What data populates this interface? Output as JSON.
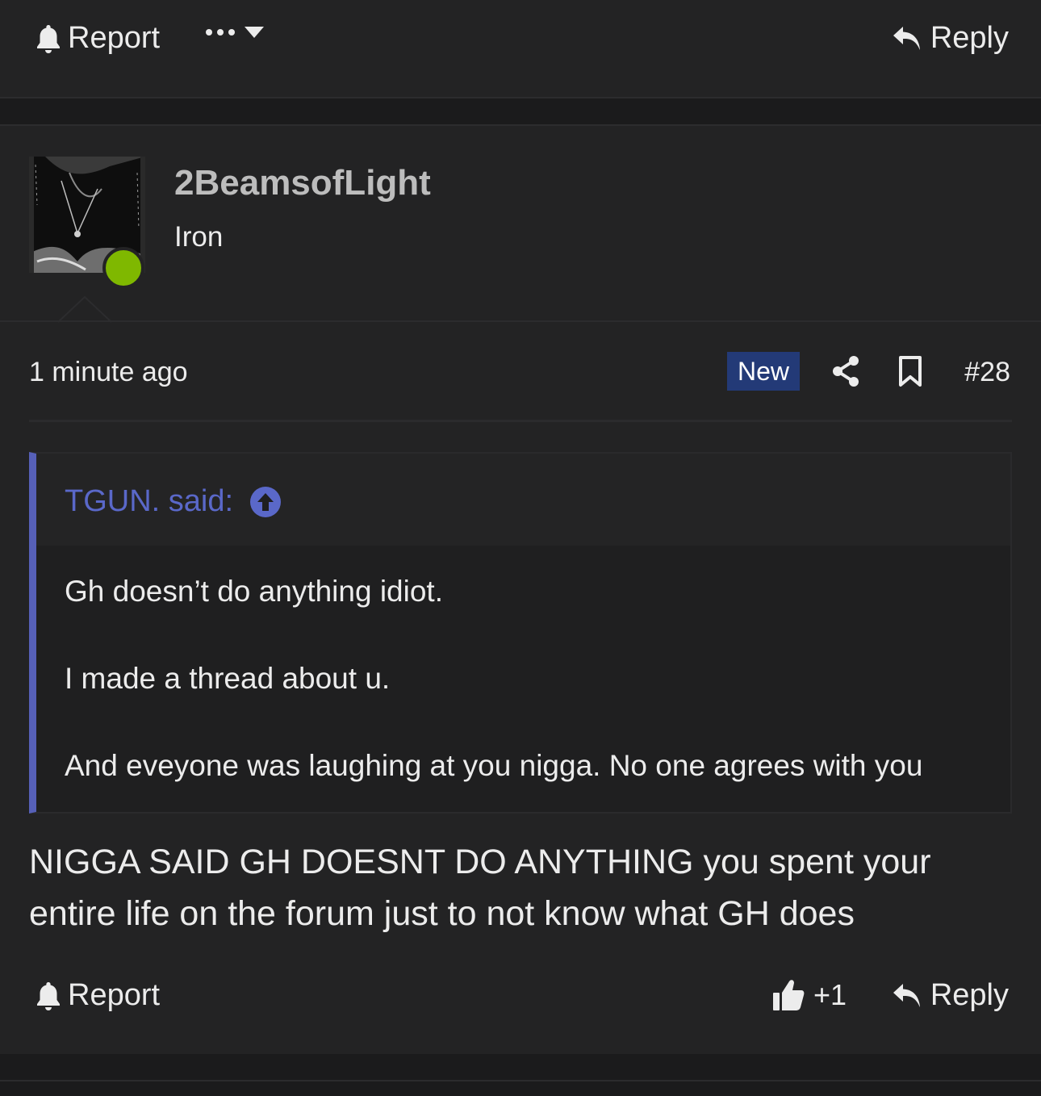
{
  "top_actions": {
    "report_label": "Report",
    "reply_label": "Reply"
  },
  "post": {
    "username": "2BeamsofLight",
    "user_title": "Iron",
    "timestamp": "1 minute ago",
    "badge": "New",
    "post_number": "#28",
    "quote": {
      "author": "TGUN. said:",
      "lines": [
        "Gh doesn’t do anything idiot.",
        "I made a thread about u.",
        "And eveyone was laughing at you nigga. No one agrees with you"
      ]
    },
    "body": "NIGGA SAID GH DOESNT DO ANYTHING you spent your entire life on the forum just to not know what GH does",
    "footer": {
      "report_label": "Report",
      "reaction_count": "+1",
      "reply_label": "Reply"
    }
  },
  "colors": {
    "background": "#1b1b1c",
    "panel": "#232324",
    "quote_accent": "#5660b8",
    "quote_author": "#5a68c9",
    "new_badge": "#233a77",
    "online_status": "#7fb800"
  },
  "icons": {
    "report": "bell-icon",
    "more": "ellipsis-icon",
    "reply": "reply-arrow-icon",
    "share": "share-icon",
    "bookmark": "bookmark-icon",
    "quote_jump": "arrow-up-circle-icon",
    "reaction": "thumbs-up-icon"
  }
}
